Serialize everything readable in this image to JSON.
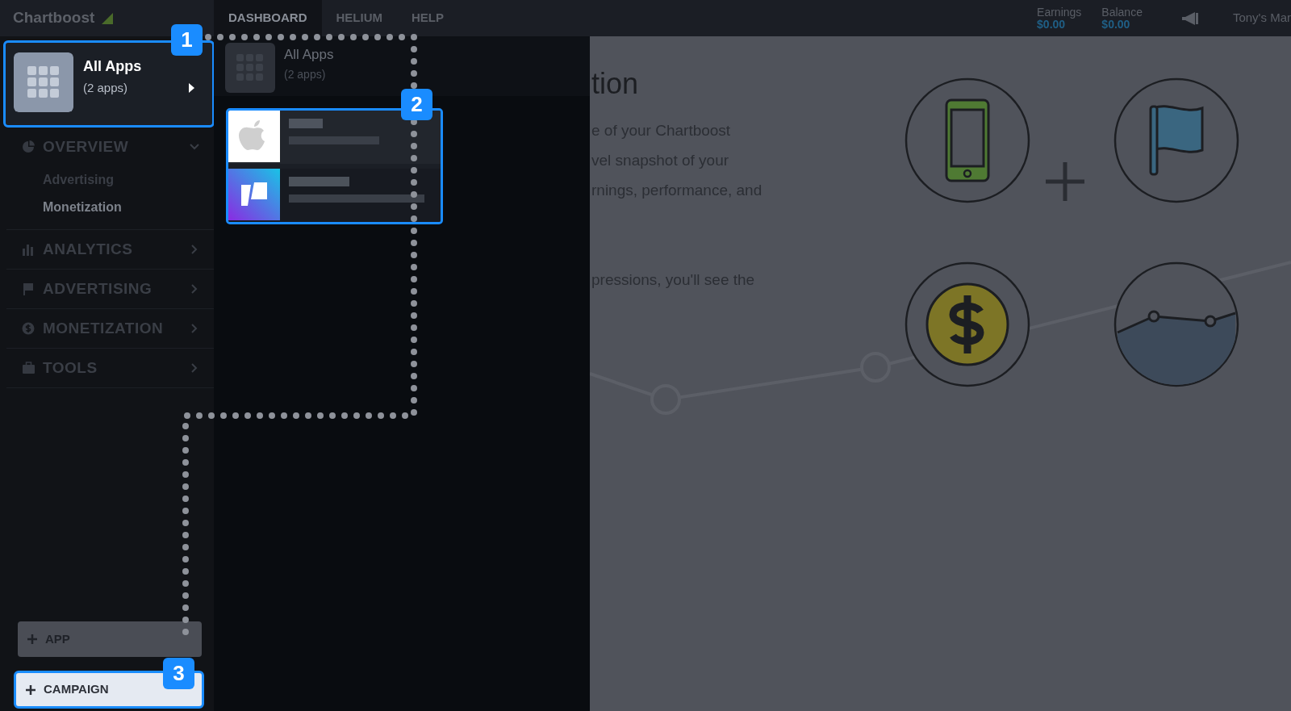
{
  "brand": {
    "name": "Chartboost"
  },
  "tabs": [
    {
      "label": "DASHBOARD",
      "selected": true
    },
    {
      "label": "HELIUM",
      "selected": false
    },
    {
      "label": "HELP",
      "selected": false
    }
  ],
  "account": {
    "earnings_label": "Earnings",
    "earnings": "$0.00",
    "balance_label": "Balance",
    "balance": "$0.00",
    "user": "Tony's Mar"
  },
  "app_selector": {
    "title": "All Apps",
    "count": "(2 apps)"
  },
  "sidebar": {
    "items": [
      {
        "label": "OVERVIEW",
        "kind": "pie",
        "expanded": true,
        "children": [
          {
            "label": "Advertising",
            "selected": false
          },
          {
            "label": "Monetization",
            "selected": true
          }
        ]
      },
      {
        "label": "ANALYTICS",
        "kind": "bars",
        "expanded": false
      },
      {
        "label": "ADVERTISING",
        "kind": "flag",
        "expanded": false
      },
      {
        "label": "MONETIZATION",
        "kind": "dollar",
        "expanded": false
      },
      {
        "label": "TOOLS",
        "kind": "toolbox",
        "expanded": false
      }
    ]
  },
  "buttons": [
    {
      "label": "APP",
      "highlighted": false
    },
    {
      "label": "CAMPAIGN",
      "highlighted": true
    }
  ],
  "app_menu": {
    "all_apps": {
      "title": "All Apps",
      "count": "(2 apps)"
    },
    "apps": [
      {
        "kind": "apple"
      },
      {
        "kind": "gradient"
      }
    ]
  },
  "content": {
    "title": "tion",
    "paragraphs": [
      [
        "e of your Chartboost",
        "vel snapshot of your",
        "rnings, performance, and"
      ],
      [
        "pressions, you'll see the"
      ]
    ]
  },
  "callouts": [
    "1",
    "2",
    "3"
  ]
}
